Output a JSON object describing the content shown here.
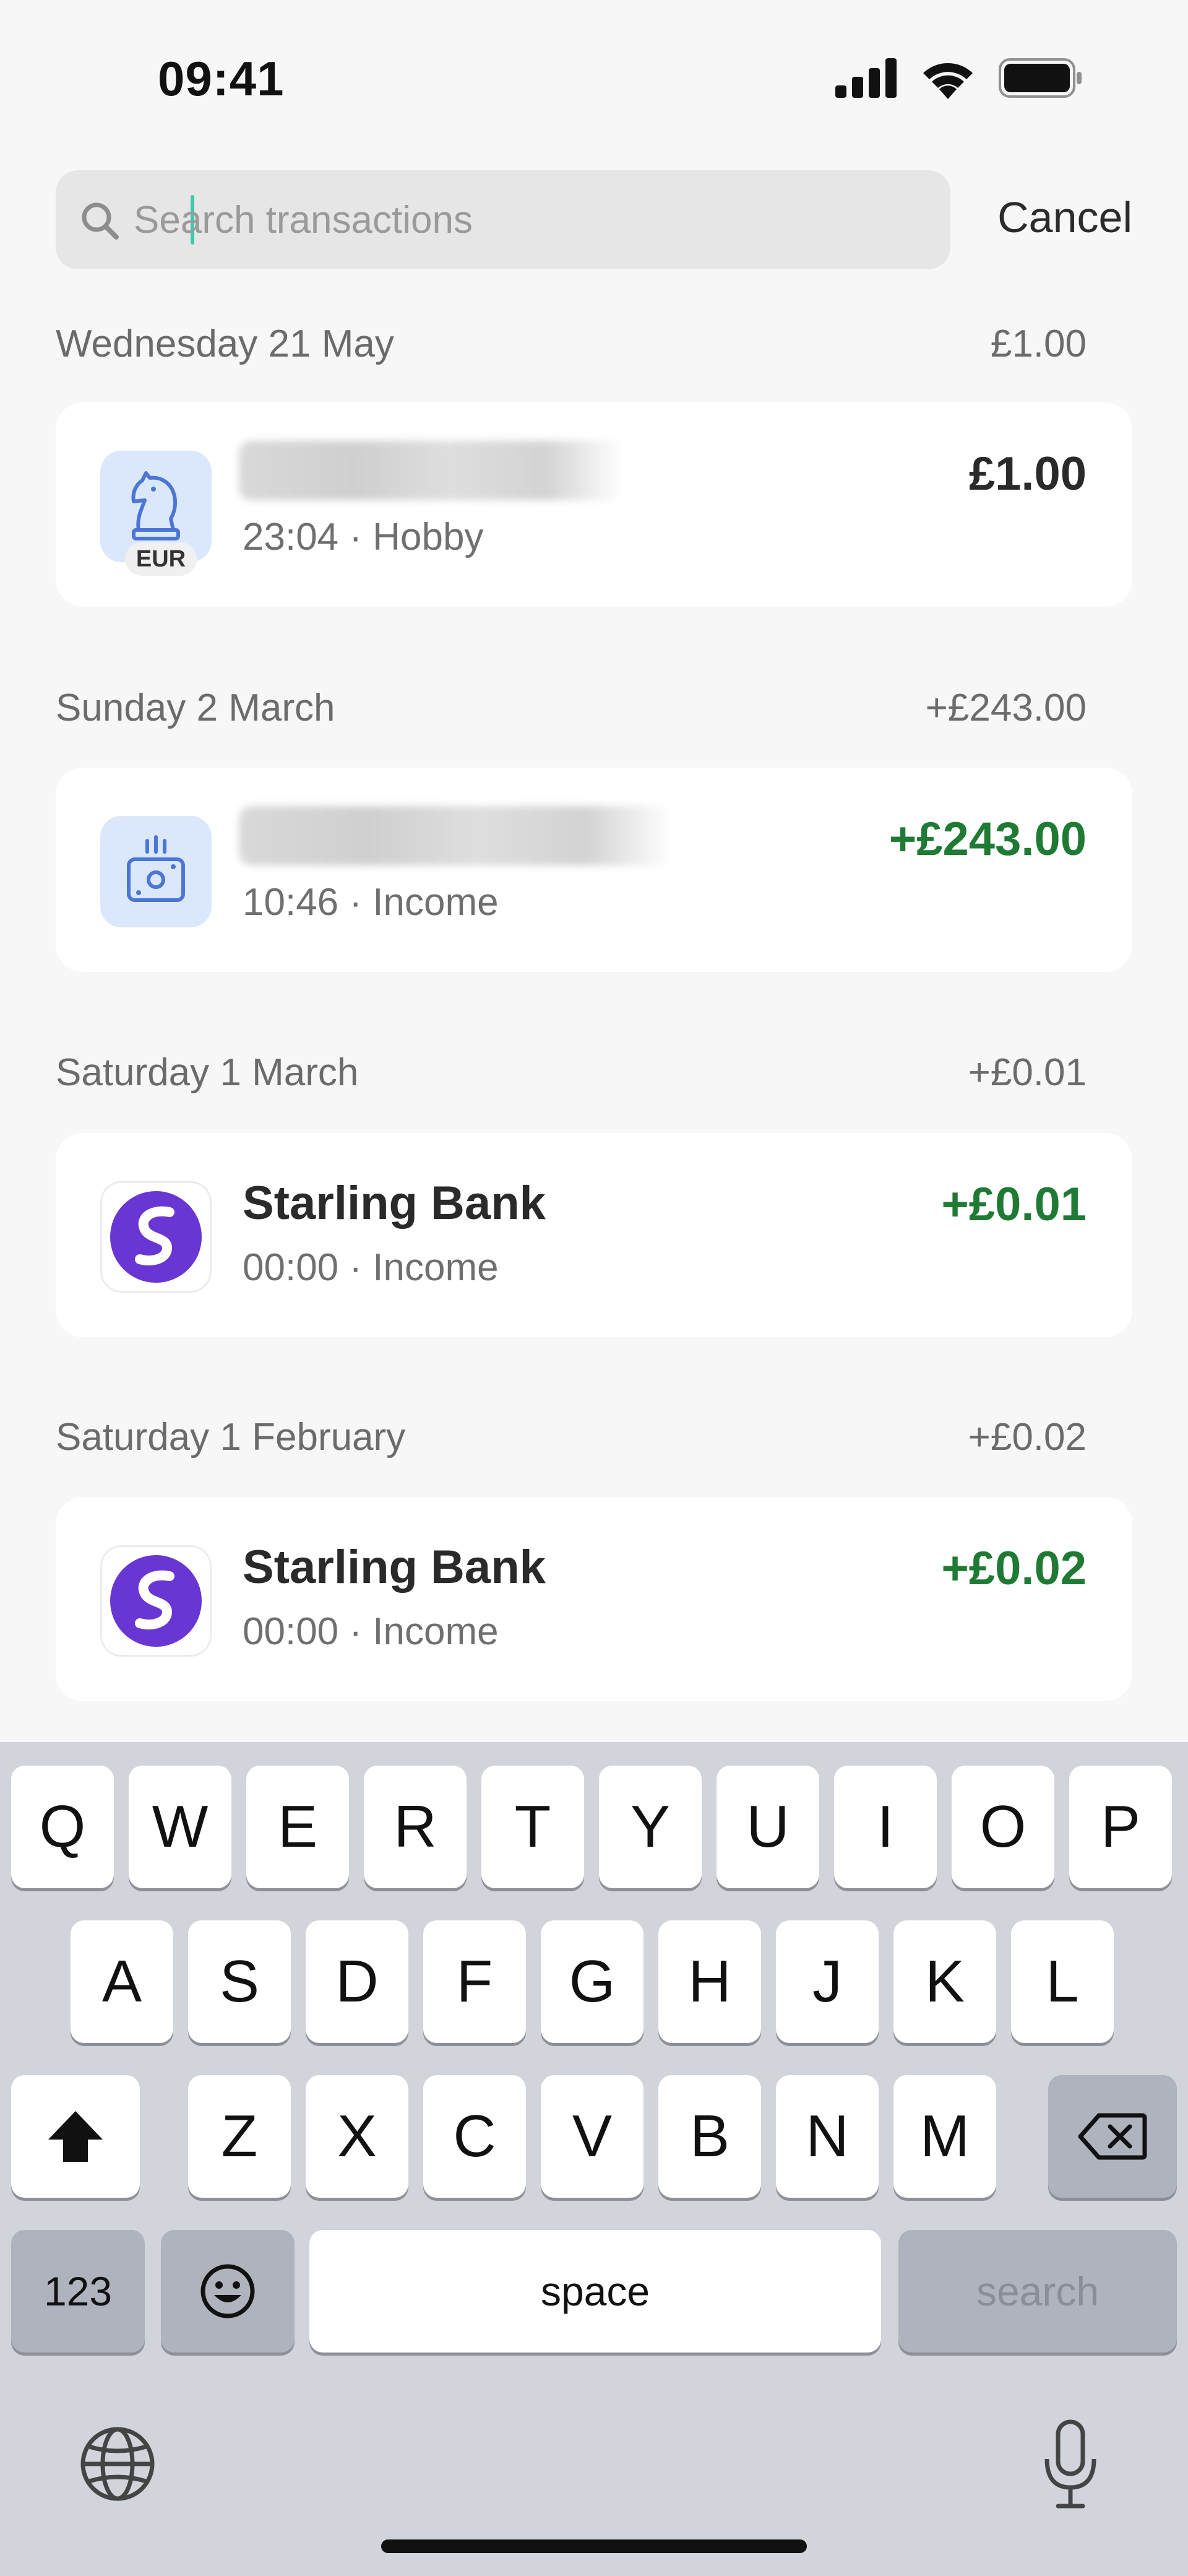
{
  "status_bar": {
    "time": "09:41",
    "icons": [
      "signal-icon",
      "wifi-icon",
      "battery-icon"
    ]
  },
  "search": {
    "placeholder": "Search transactions",
    "value": "",
    "cancel_label": "Cancel"
  },
  "sections": [
    {
      "date": "Wednesday 21 May",
      "total": "£1.00",
      "transaction": {
        "name": "",
        "name_blurred": true,
        "icon": "chess-knight-icon",
        "badge": "EUR",
        "meta": "23:04 · Hobby",
        "amount": "£1.00",
        "is_income": false
      }
    },
    {
      "date": "Sunday 2 March",
      "total": "+£243.00",
      "transaction": {
        "name": "",
        "name_blurred": true,
        "icon": "cash-income-icon",
        "meta": "10:46 · Income",
        "amount": "+£243.00",
        "is_income": true
      }
    },
    {
      "date": "Saturday 1 March",
      "total": "+£0.01",
      "transaction": {
        "name": "Starling Bank",
        "icon": "starling-logo-icon",
        "meta": "00:00 · Income",
        "amount": "+£0.01",
        "is_income": true
      }
    },
    {
      "date": "Saturday 1 February",
      "total": "+£0.02",
      "transaction": {
        "name": "Starling Bank",
        "icon": "starling-logo-icon",
        "meta": "00:00 · Income",
        "amount": "+£0.02",
        "is_income": true
      }
    }
  ],
  "keyboard": {
    "row1": [
      "Q",
      "W",
      "E",
      "R",
      "T",
      "Y",
      "U",
      "I",
      "O",
      "P"
    ],
    "row2": [
      "A",
      "S",
      "D",
      "F",
      "G",
      "H",
      "J",
      "K",
      "L"
    ],
    "row3": [
      "Z",
      "X",
      "C",
      "V",
      "B",
      "N",
      "M"
    ],
    "numbers_label": "123",
    "space_label": "space",
    "search_label": "search"
  },
  "colors": {
    "income_green": "#1f7a34",
    "starling_purple": "#6935d3",
    "caret_teal": "#3ec9b0",
    "keyboard_bg": "#d1d4db"
  }
}
